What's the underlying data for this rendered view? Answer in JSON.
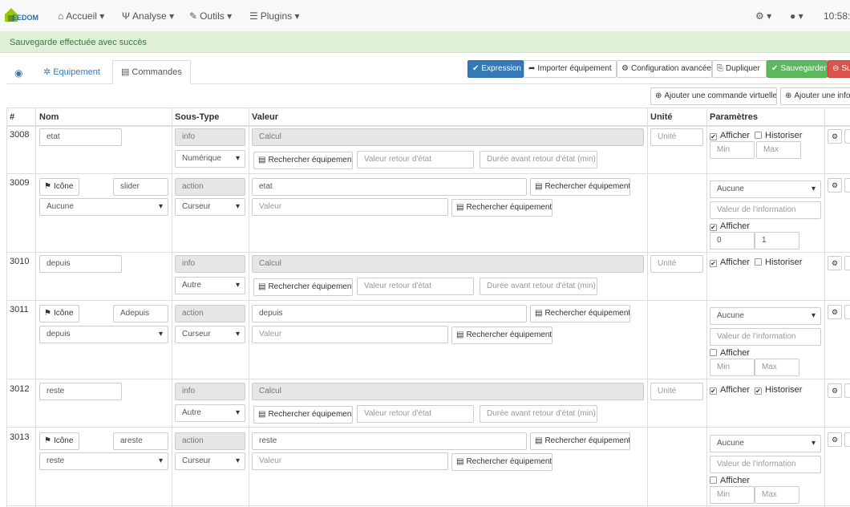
{
  "nav": {
    "logo": "EEDOM",
    "accueil": "Accueil",
    "analyse": "Analyse",
    "outils": "Outils",
    "plugins": "Plugins",
    "time": "10:58:2"
  },
  "alert": "Sauvegarde effectuée avec succès",
  "tabs": {
    "equipement": "Equipement",
    "commandes": "Commandes"
  },
  "actions": {
    "expression": "Expression",
    "importer": "Importer équipement",
    "config": "Configuration avancée",
    "dupliquer": "Dupliquer",
    "sauvegarder": "Sauvegarder",
    "supprimer": "Su"
  },
  "add": {
    "virtual": "Ajouter une commande virtuelle",
    "info": "Ajouter une info"
  },
  "headers": {
    "id": "#",
    "nom": "Nom",
    "soustype": "Sous-Type",
    "valeur": "Valeur",
    "unite": "Unité",
    "params": "Paramètres"
  },
  "labels": {
    "icone": "Icône",
    "calcul": "Calcul",
    "rechercher": "Rechercher équipement",
    "valeur_retour": "Valeur retour d'état",
    "duree_retour": "Durée avant retour d'état (min)",
    "valeur": "Valeur",
    "unite": "Unité",
    "afficher": "Afficher",
    "historiser": "Historiser",
    "min": "Min",
    "max": "Max",
    "valeur_info": "Valeur de l'information",
    "aucune": "Aucune"
  },
  "rows": [
    {
      "id": "3008",
      "name": "etat",
      "type": "info",
      "subtype": "Numérique",
      "afficher": true,
      "historiser": false
    },
    {
      "id": "3009",
      "name": "slider",
      "type": "action",
      "subtype": "Curseur",
      "value": "etat",
      "linked": "Aucune",
      "afficher": true,
      "min": "0",
      "max": "1"
    },
    {
      "id": "3010",
      "name": "depuis",
      "type": "info",
      "subtype": "Autre",
      "afficher": true,
      "historiser": false
    },
    {
      "id": "3011",
      "name": "Adepuis",
      "type": "action",
      "subtype": "Curseur",
      "value": "depuis",
      "linked": "depuis",
      "afficher": false
    },
    {
      "id": "3012",
      "name": "reste",
      "type": "info",
      "subtype": "Autre",
      "afficher": true,
      "historiser": true
    },
    {
      "id": "3013",
      "name": "areste",
      "type": "action",
      "subtype": "Curseur",
      "value": "reste",
      "linked": "reste",
      "afficher": false
    }
  ]
}
